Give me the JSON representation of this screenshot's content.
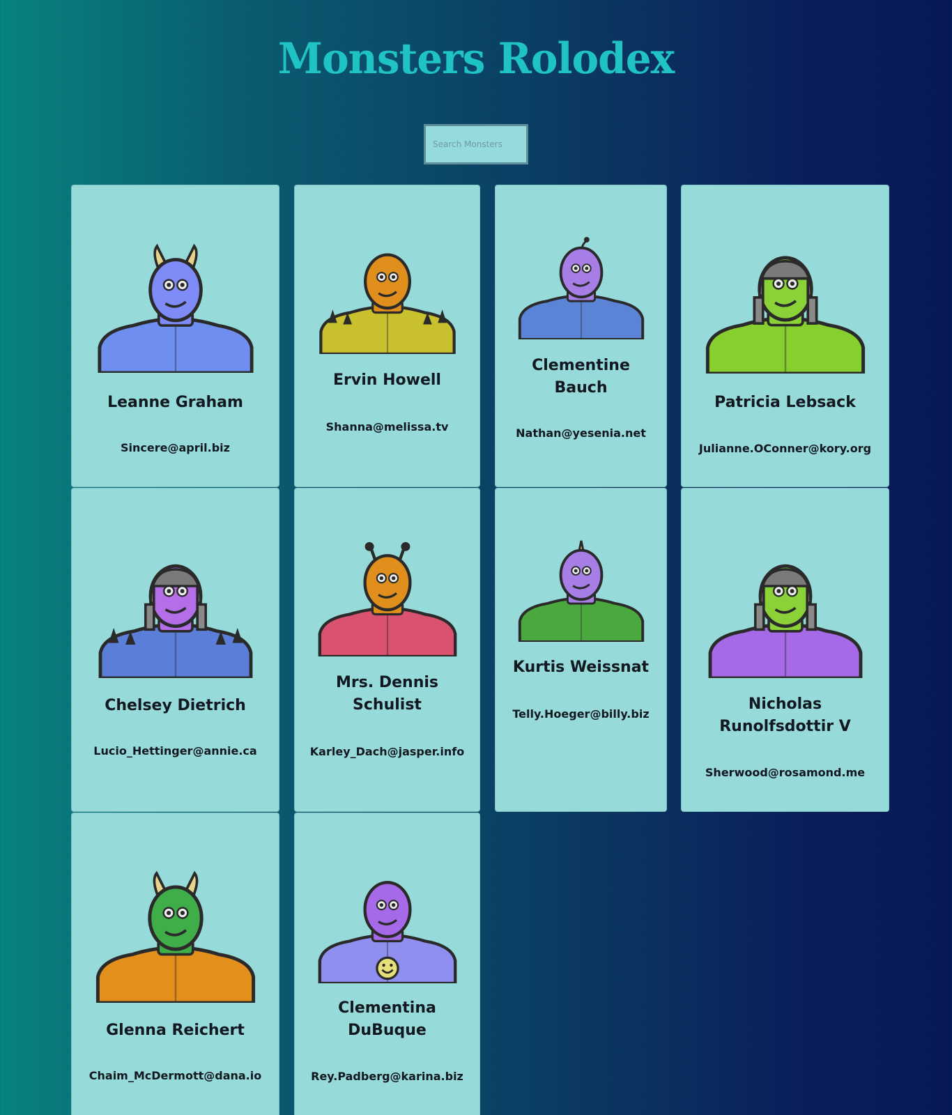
{
  "app": {
    "title": "Monsters Rolodex"
  },
  "search": {
    "placeholder": "Search Monsters"
  },
  "monsters": [
    {
      "name": "Leanne Graham",
      "email": "Sincere@april.biz",
      "body_color": "#6f8ff0",
      "skin_color": "#7f8cf8",
      "icon": "horned-monster-icon"
    },
    {
      "name": "Ervin Howell",
      "email": "Shanna@melissa.tv",
      "body_color": "#c8c02c",
      "skin_color": "#e08f1c",
      "icon": "spiky-monster-icon"
    },
    {
      "name": "Clementine Bauch",
      "email": "Nathan@yesenia.net",
      "body_color": "#5b83d6",
      "skin_color": "#a67ee6",
      "icon": "cyclops-robot-monster-icon"
    },
    {
      "name": "Patricia Lebsack",
      "email": "Julianne.OConner@kory.org",
      "body_color": "#86cf2f",
      "skin_color": "#8ad238",
      "icon": "helmet-monster-icon"
    },
    {
      "name": "Chelsey Dietrich",
      "email": "Lucio_Hettinger@annie.ca",
      "body_color": "#5b7fd9",
      "skin_color": "#b36ee8",
      "icon": "helmet-spiky-monster-icon"
    },
    {
      "name": "Mrs. Dennis Schulist",
      "email": "Karley_Dach@jasper.info",
      "body_color": "#d9526f",
      "skin_color": "#e08f1c",
      "icon": "antenna-monster-icon"
    },
    {
      "name": "Kurtis Weissnat",
      "email": "Telly.Hoeger@billy.biz",
      "body_color": "#4aa83f",
      "skin_color": "#a67ee6",
      "icon": "unicorn-monster-icon"
    },
    {
      "name": "Nicholas Runolfsdottir V",
      "email": "Sherwood@rosamond.me",
      "body_color": "#a66ae8",
      "skin_color": "#8ad238",
      "icon": "helmet-monster-icon"
    },
    {
      "name": "Glenna Reichert",
      "email": "Chaim_McDermott@dana.io",
      "body_color": "#e38f1c",
      "skin_color": "#3fae49",
      "icon": "bull-horned-monster-icon"
    },
    {
      "name": "Clementina DuBuque",
      "email": "Rey.Padberg@karina.biz",
      "body_color": "#8f8ff0",
      "skin_color": "#a66ae8",
      "icon": "smiley-shirt-monster-icon"
    }
  ]
}
